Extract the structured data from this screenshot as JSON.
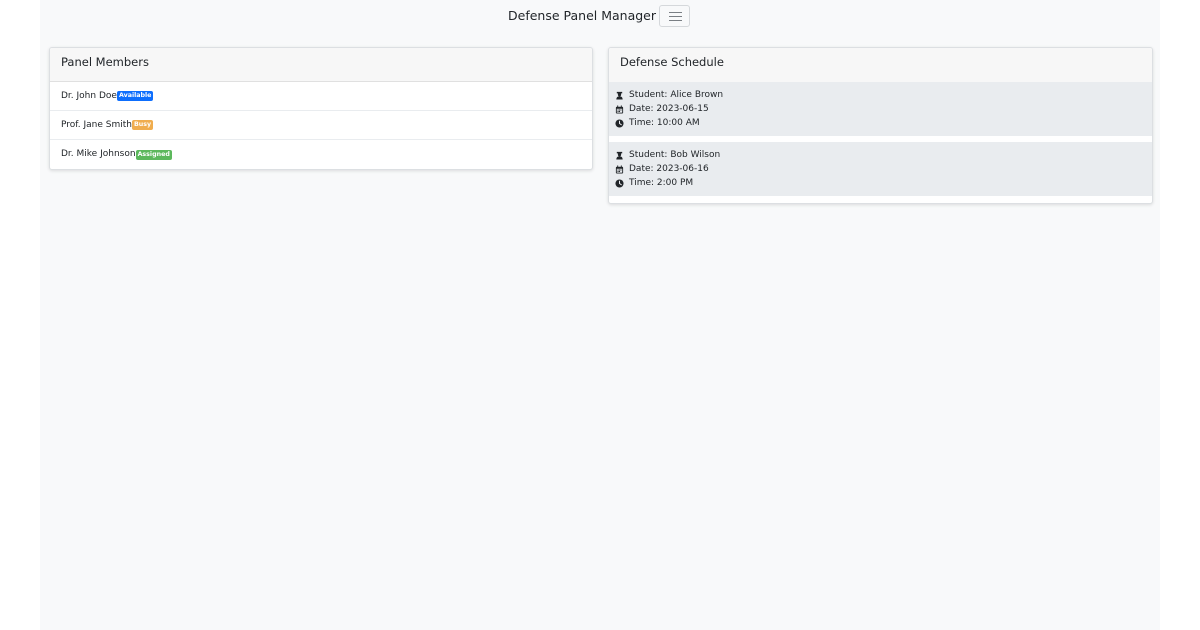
{
  "navbar": {
    "brand": "Defense Panel Manager",
    "toggler_icon": "hamburger-icon"
  },
  "panel_members": {
    "title": "Panel Members",
    "items": [
      {
        "name": "Dr. John Doe",
        "status": "Available",
        "status_color": "#0d6efd"
      },
      {
        "name": "Prof. Jane Smith",
        "status": "Busy",
        "status_color": "#f0ad4e"
      },
      {
        "name": "Dr. Mike Johnson",
        "status": "Assigned",
        "status_color": "#5cb85c"
      }
    ]
  },
  "defense_schedule": {
    "title": "Defense Schedule",
    "icons": {
      "student": "graduate-icon",
      "date": "calendar-icon",
      "time": "clock-icon"
    },
    "entries": [
      {
        "student": "Student: Alice Brown",
        "date": "Date: 2023-06-15",
        "time": "Time: 10:00 AM"
      },
      {
        "student": "Student: Bob Wilson",
        "date": "Date: 2023-06-16",
        "time": "Time: 2:00 PM"
      }
    ]
  }
}
